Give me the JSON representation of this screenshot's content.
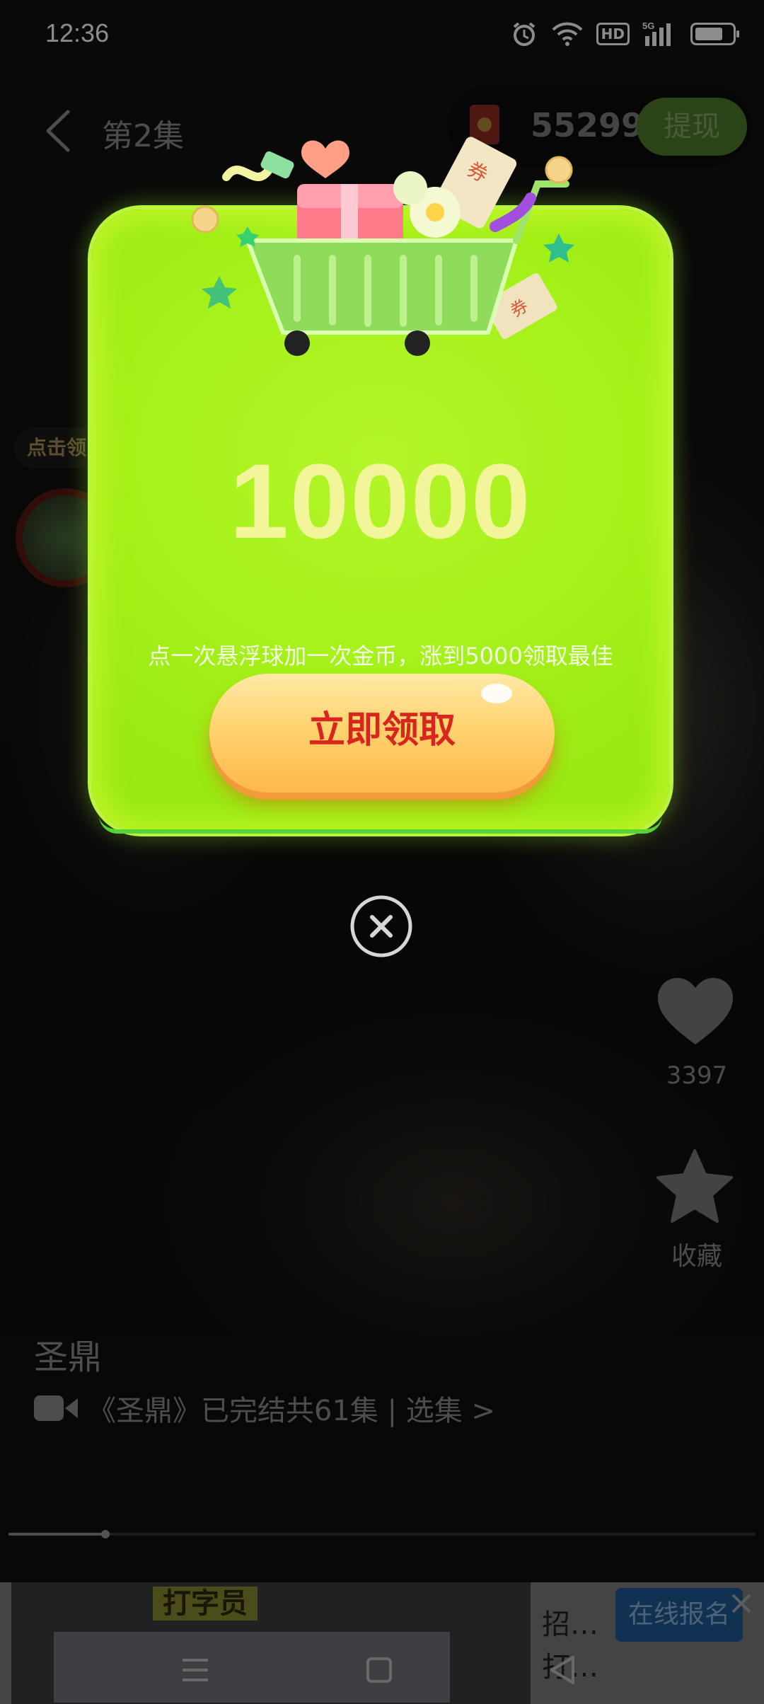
{
  "status_bar": {
    "time": "12:36",
    "hd_label": "HD",
    "network_label": "5G",
    "battery_level": 0.9
  },
  "nav": {
    "episode_title": "第2集",
    "coin_count": "55299",
    "withdraw_label": "提现"
  },
  "floating_ball": {
    "tip": "点击领"
  },
  "actions": {
    "like_count": "3397",
    "favorite_label": "收藏"
  },
  "drama": {
    "name": "圣鼎",
    "info": "《圣鼎》已完结共61集 | 选集 >"
  },
  "progress": {
    "played_fraction": 0.13
  },
  "ad": {
    "thumb_title": "打字员",
    "text_line1": "招…",
    "text_line2": "打…",
    "cta": "在线报名"
  },
  "popup": {
    "amount": "10000",
    "description": "点一次悬浮球加一次金币，涨到5000领取最佳",
    "claim_label": "立即领取"
  },
  "colors": {
    "popup_green": "#a6f21a",
    "claim_text": "#d8251d",
    "amount_text": "#f3f59a"
  }
}
